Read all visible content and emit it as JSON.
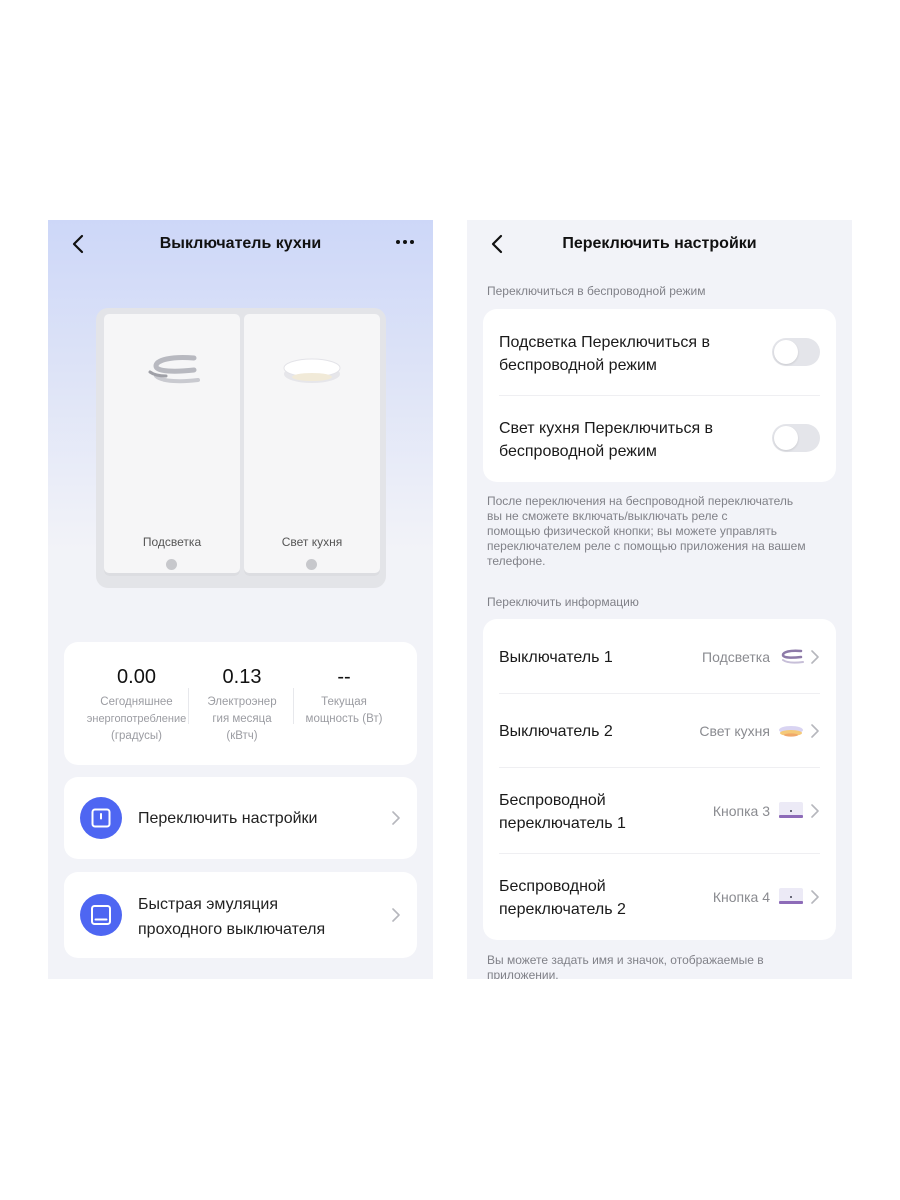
{
  "left_screen": {
    "title": "Выключатель кухни",
    "keys": [
      {
        "label": "Подсветка",
        "icon": "strip-light-icon"
      },
      {
        "label": "Свет кухня",
        "icon": "ceiling-lamp-icon"
      }
    ],
    "stats": [
      {
        "value": "0.00",
        "label_lines": [
          "Сегодняшнее",
          "энергопотребление",
          "(градусы)"
        ]
      },
      {
        "value": "0.13",
        "label_lines": [
          "Электроэнер",
          "гия месяца",
          "(кВтч)"
        ]
      },
      {
        "value": "--",
        "label_lines": [
          "Текущая",
          "мощность (Вт)"
        ]
      }
    ],
    "menu": [
      {
        "label": "Переключить настройки",
        "icon": "switch-settings-icon"
      },
      {
        "label_lines": [
          "Быстрая эмуляция",
          "проходного выключателя"
        ],
        "icon": "emulation-icon"
      }
    ],
    "colors": {
      "accent": "#4e66f2",
      "gradient_top": "#cdd7f8",
      "background": "#f2f3f8"
    }
  },
  "right_screen": {
    "title": "Переключить настройки",
    "wireless_section_title": "Переключиться в беспроводной режим",
    "wireless_toggles": [
      {
        "label_lines": [
          "Подсветка Переключиться в",
          "беспроводной режим"
        ],
        "on": false
      },
      {
        "label_lines": [
          "Свет кухня Переключиться в",
          "беспроводной режим"
        ],
        "on": false
      }
    ],
    "wireless_note_lines": [
      "После переключения на беспроводной переключатель",
      "вы не сможете включать/выключать реле с",
      "помощью физической кнопки; вы можете управлять",
      "переключателем реле с помощью приложения на вашем",
      "телефоне."
    ],
    "info_section_title": "Переключить информацию",
    "info_rows": [
      {
        "label_lines": [
          "Выключатель 1"
        ],
        "value": "Подсветка",
        "icon": "strip-light-icon"
      },
      {
        "label_lines": [
          "Выключатель 2"
        ],
        "value": "Свет кухня",
        "icon": "ceiling-lamp-icon"
      },
      {
        "label_lines": [
          "Беспроводной",
          "переключатель 1"
        ],
        "value": "Кнопка 3",
        "icon": "wireless-button-icon"
      },
      {
        "label_lines": [
          "Беспроводной",
          "переключатель 2"
        ],
        "value": "Кнопка 4",
        "icon": "wireless-button-icon"
      }
    ],
    "footer_note_lines": [
      "Вы можете задать имя и значок, отображаемые в",
      "приложении."
    ]
  }
}
